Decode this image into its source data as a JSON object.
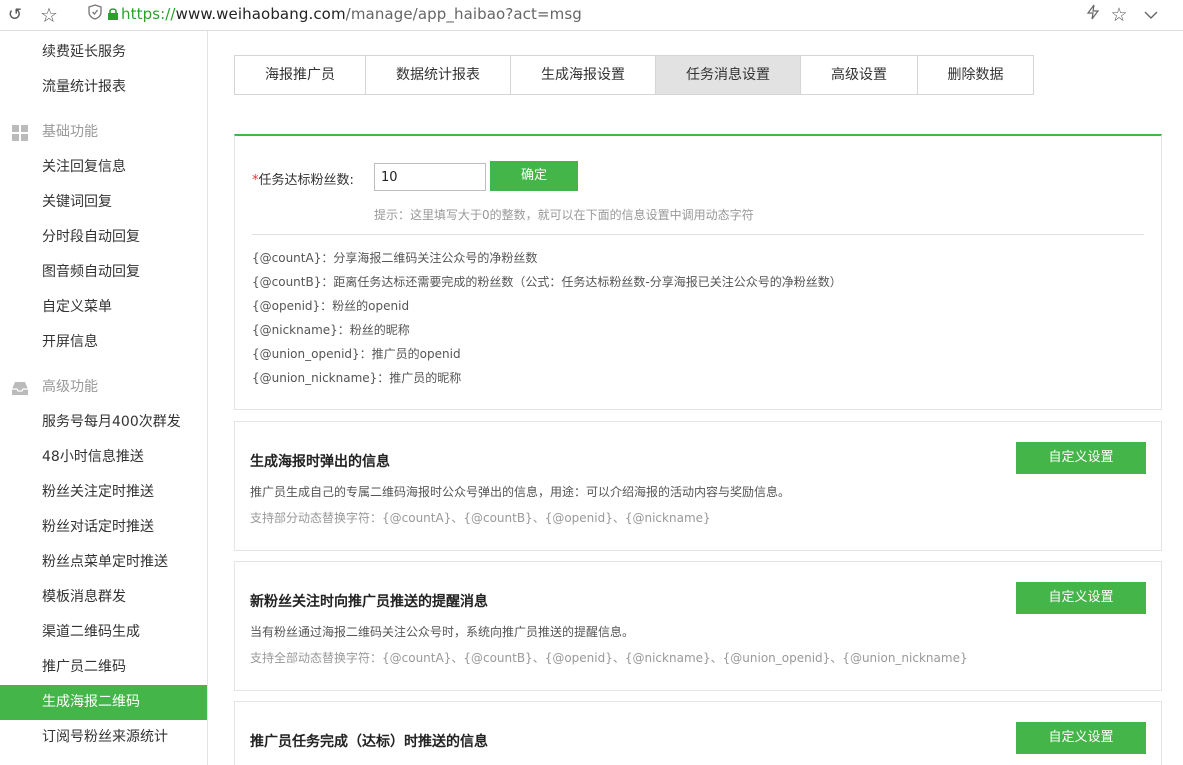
{
  "browser": {
    "url_scheme": "https://",
    "url_host": "www.weihaobang.com",
    "url_path": "/manage/app_haibao?act=msg"
  },
  "sidebar": {
    "items_top": [
      "续费延长服务",
      "流量统计报表"
    ],
    "group_basic": "基础功能",
    "items_basic": [
      "关注回复信息",
      "关键词回复",
      "分时段自动回复",
      "图音频自动回复",
      "自定义菜单",
      "开屏信息"
    ],
    "group_advanced": "高级功能",
    "items_advanced": [
      "服务号每月400次群发",
      "48小时信息推送",
      "粉丝关注定时推送",
      "粉丝对话定时推送",
      "粉丝点菜单定时推送",
      "模板消息群发",
      "渠道二维码生成",
      "推广员二维码",
      "生成海报二维码",
      "订阅号粉丝来源统计"
    ],
    "active": "生成海报二维码"
  },
  "tabs": {
    "labels": [
      "海报推广员",
      "数据统计报表",
      "生成海报设置",
      "任务消息设置",
      "高级设置",
      "删除数据"
    ],
    "active": "任务消息设置"
  },
  "form": {
    "required_mark": "*",
    "label": "任务达标粉丝数:",
    "value": "10",
    "confirm_label": "确定",
    "hint": "提示：这里填写大于0的整数，就可以在下面的信息设置中调用动态字符"
  },
  "variables": [
    "{@countA}：分享海报二维码关注公众号的净粉丝数",
    "{@countB}：距离任务达标还需要完成的粉丝数（公式：任务达标粉丝数-分享海报已关注公众号的净粉丝数）",
    "{@openid}：粉丝的openid",
    "{@nickname}：粉丝的昵称",
    "{@union_openid}：推广员的openid",
    "{@union_nickname}：推广员的昵称"
  ],
  "cards": [
    {
      "title": "生成海报时弹出的信息",
      "desc": "推广员生成自己的专属二维码海报时公众号弹出的信息，用途：可以介绍海报的活动内容与奖励信息。",
      "sub": "支持部分动态替换字符：{@countA}、{@countB}、{@openid}、{@nickname}",
      "button": "自定义设置"
    },
    {
      "title": "新粉丝关注时向推广员推送的提醒消息",
      "desc": "当有粉丝通过海报二维码关注公众号时，系统向推广员推送的提醒信息。",
      "sub": "支持全部动态替换字符：{@countA}、{@countB}、{@openid}、{@nickname}、{@union_openid}、{@union_nickname}",
      "button": "自定义设置"
    },
    {
      "title": "推广员任务完成（达标）时推送的信息",
      "desc": "",
      "sub": "",
      "button": "自定义设置"
    }
  ],
  "colors": {
    "accent": "#44b549",
    "required": "#ee3333"
  }
}
